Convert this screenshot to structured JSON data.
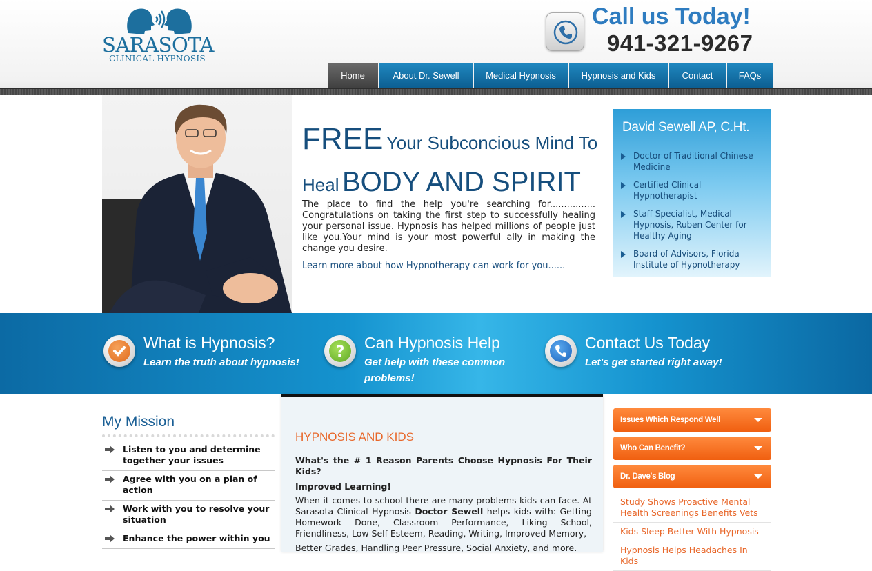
{
  "logo": {
    "title": "SARASOTA",
    "subtitle": "CLINICAL HYPNOSIS"
  },
  "header": {
    "call_title": "Call us Today!",
    "phone": "941-321-9267"
  },
  "nav": [
    {
      "label": "Home",
      "active": true
    },
    {
      "label": "About Dr. Sewell",
      "active": false
    },
    {
      "label": "Medical Hypnosis",
      "active": false
    },
    {
      "label": "Hypnosis and Kids",
      "active": false
    },
    {
      "label": "Contact",
      "active": false
    },
    {
      "label": "FAQs",
      "active": false
    }
  ],
  "hero": {
    "headline_1": "FREE",
    "headline_2": "Your Subconcious Mind To",
    "headline_3": "Heal",
    "headline_4": "BODY AND SPIRIT",
    "body": "The place to find the help you're searching for................ Congratulations on taking the first step to successfully healing your personal issue. Hypnosis has helped millions of people just like you.Your mind is your most powerful ally in making the change you desire.",
    "link": "Learn more about how Hypnotherapy can work for you......"
  },
  "credentials": {
    "title": "David Sewell AP, C.Ht.",
    "items": [
      "Doctor of Traditional Chinese Medicine",
      "Certified Clinical Hypnotherapist",
      "Staff Specialist, Medical Hypnosis, Ruben Center for Healthy Aging",
      "Board of Advisors, Florida Institute of Hypnotherapy"
    ]
  },
  "features": [
    {
      "title": "What is Hypnosis?",
      "subtitle": "Learn the truth about hypnosis!",
      "icon": "checkmark-icon",
      "color": "#e8742a"
    },
    {
      "title": "Can Hypnosis Help",
      "subtitle": "Get help with these common problems!",
      "icon": "question-icon",
      "color": "#7cc23a"
    },
    {
      "title": "Contact Us Today",
      "subtitle": "Let's get started right away!",
      "icon": "phone-icon",
      "color": "#2a7fd0"
    }
  ],
  "mission": {
    "title": "My Mission",
    "items": [
      "Listen to you and determine together your issues",
      "Agree with you on a plan of action",
      "Work with you to resolve your situation",
      "Enhance the power within you"
    ]
  },
  "kids": {
    "title": "HYPNOSIS AND KIDS",
    "question": "What's the # 1 Reason Parents Choose Hypnosis For Their Kids?",
    "subheading": "Improved Learning!",
    "text_before": "When it comes to school there are many problems kids can face. At Sarasota Clinical Hypnosis ",
    "text_bold": "Doctor Sewell",
    "text_after": " helps kids with: Getting Homework Done, Classroom Performance, Liking School, Friendliness, Low Self-Esteem, Reading, Writing, Improved Memory,",
    "text_2": "Better Grades, Handling Peer Pressure, Social Anxiety, and more."
  },
  "sidebar": {
    "accordions": [
      "Issues Which Respond Well",
      "Who Can Benefit?",
      "Dr. Dave's Blog"
    ],
    "blog_links": [
      "Study Shows Proactive Mental Health Screenings Benefits Vets",
      "Kids Sleep Better With Hypnosis",
      "Hypnosis Helps Headaches In Kids"
    ]
  },
  "colors": {
    "brand_blue": "#1d6f9e",
    "nav_blue": "#0c5e91",
    "accent_orange": "#f05f10"
  }
}
